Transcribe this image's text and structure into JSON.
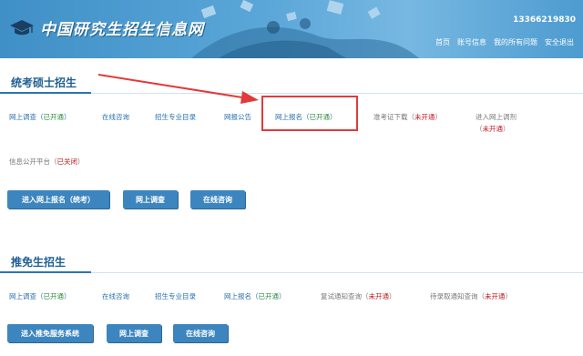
{
  "header": {
    "site_title": "中国研究生招生信息网",
    "phone": "13366219830",
    "nav": [
      "首页",
      "账号信息",
      "我的所有问题",
      "安全退出"
    ]
  },
  "section1": {
    "title": "统考硕士招生",
    "links": [
      {
        "label": "网上调查",
        "status": "已开通",
        "status_color": "green"
      },
      {
        "label": "在线咨询"
      },
      {
        "label": "招生专业目录"
      },
      {
        "label": "网报公告"
      },
      {
        "label": "网上报名",
        "status": "已开通",
        "status_color": "green"
      },
      {
        "label": "准考证下载",
        "status": "未开通",
        "status_color": "red"
      },
      {
        "label": "进入网上调剂",
        "status": "未开通",
        "status_color": "red"
      },
      {
        "label": "信息公开平台",
        "status": "已关闭",
        "status_color": "red"
      }
    ],
    "buttons": [
      "进入网上报名（统考）",
      "网上调查",
      "在线咨询"
    ]
  },
  "section2": {
    "title": "推免生招生",
    "links": [
      {
        "label": "网上调查",
        "status": "已开通",
        "status_color": "green"
      },
      {
        "label": "在线咨询"
      },
      {
        "label": "招生专业目录"
      },
      {
        "label": "网上报名",
        "status": "已开通",
        "status_color": "green"
      },
      {
        "label": "复试通知查询",
        "status": "未开通",
        "status_color": "red"
      },
      {
        "label": "待录取通知查询",
        "status": "未开通",
        "status_color": "red"
      }
    ],
    "buttons": [
      "进入推免服务系统",
      "网上调查",
      "在线咨询"
    ]
  },
  "colors": {
    "header_blue": "#4d9bd0",
    "link_blue": "#2a6fb0",
    "open_green": "#2a8a3a",
    "closed_red": "#c0161b",
    "button_blue": "#3d85be",
    "annotation_red": "#e23a3a"
  }
}
